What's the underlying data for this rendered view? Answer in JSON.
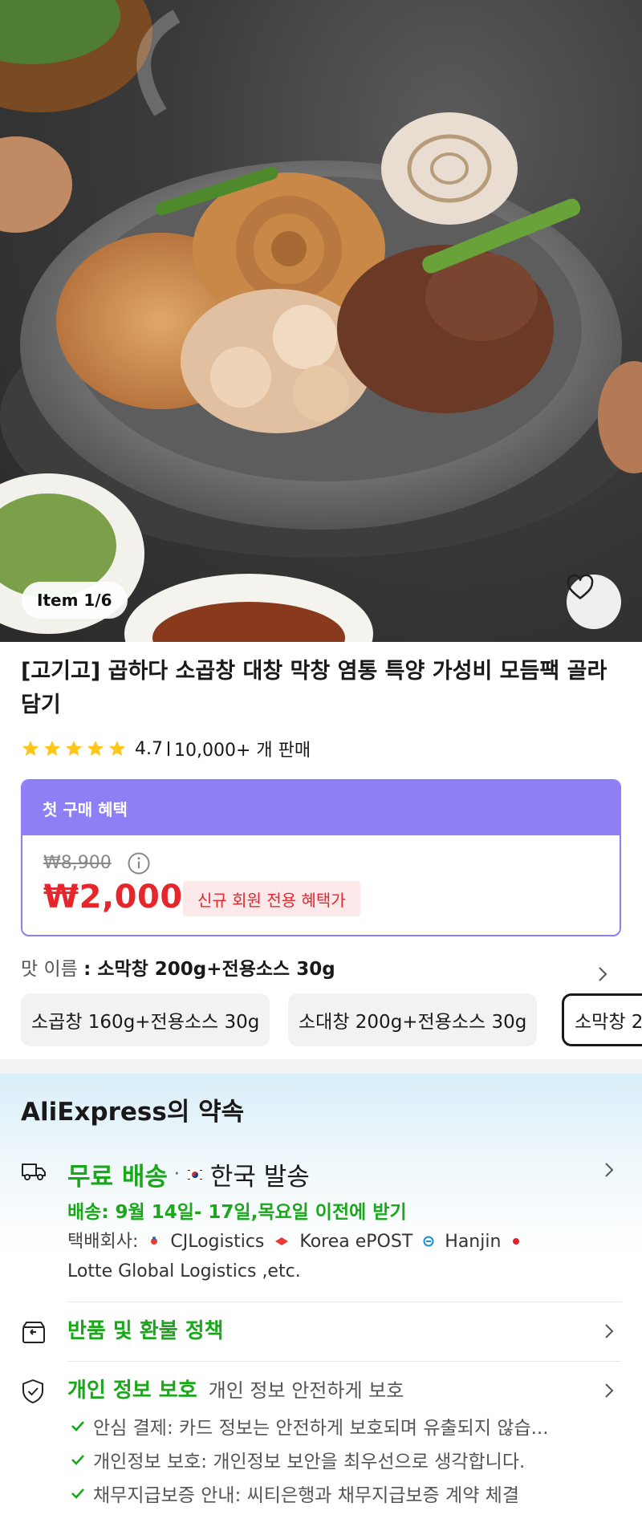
{
  "gallery": {
    "counter": "Item 1/6",
    "image_subject": "grilled beef tripe platter on stone plate"
  },
  "product": {
    "title": "[고기고] 곱하다 소곱창 대창 막창 염통 특양 가성비 모듬팩 골라담기",
    "rating": "4.7",
    "sold": "10,000+ 개 판매",
    "star_count": 5
  },
  "offer": {
    "header": "첫 구매 혜택",
    "original_price": "₩8,900",
    "price": "₩2,000",
    "badge": "신규 회원 전용 혜택가"
  },
  "variant": {
    "label": "맛 이름",
    "selected": ": 소막창 200g+전용소스 30g",
    "options": [
      "소곱창 160g+전용소스 30g",
      "소대창 200g+전용소스 30g",
      "소막창 200g+전용소스 30g"
    ]
  },
  "promise": {
    "title": "AliExpress의 약속",
    "shipping": {
      "free": "무료 배송",
      "dot": "·",
      "origin": "한국 발송",
      "eta": "배송: 9월 14일- 17일,목요일 이전에 받기",
      "carrier_label": "택배회사:",
      "carriers": [
        "CJLogistics",
        "Korea ePOST",
        "Hanjin"
      ],
      "carrier_last": "Lotte Global Logistics ,etc."
    },
    "refund": "반품 및 환불 정책",
    "privacy": {
      "title": "개인 정보 보호",
      "subtitle": "개인 정보 안전하게 보호",
      "items": [
        "안심 결제: 카드 정보는 안전하게 보호되며 유출되지 않습...",
        "개인정보 보호: 개인정보 보안을 최우선으로 생각합니다.",
        "채무지급보증 안내: 씨티은행과 채무지급보증 계약 체결"
      ]
    }
  },
  "colors": {
    "price_red": "#e5272b",
    "offer_purple": "#8e7ff5",
    "promise_green": "#1aa81a",
    "star_yellow": "#ffc61a"
  },
  "icons": [
    "heart-icon",
    "star-icon",
    "info-icon",
    "chevron-right-icon",
    "truck-icon",
    "return-box-icon",
    "shield-check-icon",
    "check-icon",
    "korea-flag-icon"
  ]
}
